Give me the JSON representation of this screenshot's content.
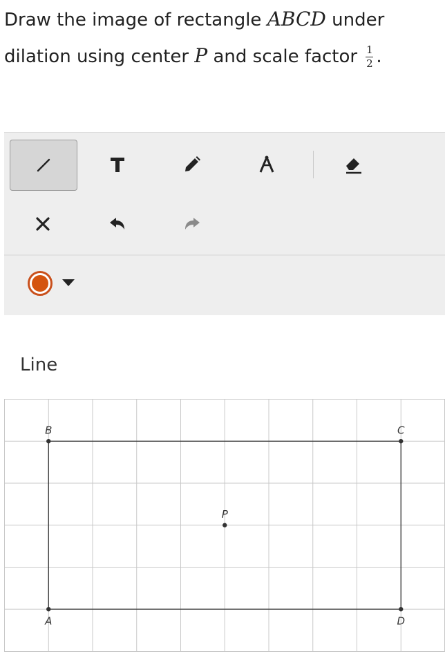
{
  "prompt": {
    "line1_pre": "Draw the image of rectangle ",
    "line1_math": "ABCD",
    "line1_post": " under",
    "line2_pre": "dilation using center ",
    "line2_math": "P",
    "line2_post": " and scale factor ",
    "frac_num": "1",
    "frac_den": "2",
    "line2_end": "."
  },
  "toolbar": {
    "tools": [
      {
        "name": "line-icon",
        "active": true
      },
      {
        "name": "text-icon",
        "glyph": "T"
      },
      {
        "name": "pencil-icon"
      },
      {
        "name": "compass-icon"
      },
      {
        "name": "eraser-icon"
      }
    ],
    "actions": [
      "close-icon",
      "undo-icon",
      "redo-icon"
    ],
    "color": "#d4540f",
    "color_ring": "#c9501c",
    "active_tool_label": "Line"
  },
  "grid": {
    "columns": 10,
    "rows": 6,
    "points": [
      {
        "label": "B",
        "x": 1,
        "y": 5
      },
      {
        "label": "C",
        "x": 9,
        "y": 5
      },
      {
        "label": "P",
        "x": 5,
        "y": 3
      },
      {
        "label": "A",
        "x": 1,
        "y": 1
      },
      {
        "label": "D",
        "x": 9,
        "y": 1
      }
    ],
    "rectangle": [
      "A",
      "B",
      "C",
      "D"
    ]
  }
}
